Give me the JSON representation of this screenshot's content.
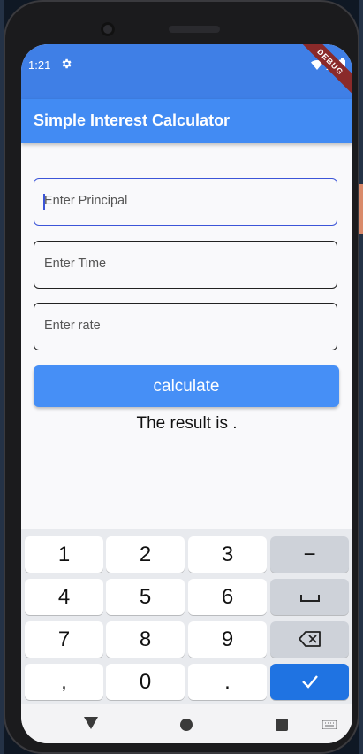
{
  "status_bar": {
    "time": "1:21",
    "debug_label": "DEBUG"
  },
  "app_bar": {
    "title": "Simple Interest Calculator"
  },
  "form": {
    "principal_placeholder": "Enter Principal",
    "time_placeholder": "Enter Time",
    "rate_placeholder": "Enter rate",
    "calculate_label": "calculate",
    "result_text": "The result is ."
  },
  "keyboard": {
    "rows": [
      [
        "1",
        "2",
        "3",
        "−"
      ],
      [
        "4",
        "5",
        "6",
        "space-icon"
      ],
      [
        "7",
        "8",
        "9",
        "backspace-icon"
      ],
      [
        ",",
        "0",
        ".",
        "check-icon"
      ]
    ]
  },
  "colors": {
    "status_bar": "#3f7fe6",
    "app_bar": "#428bf3",
    "button": "#468ff6",
    "focus_border": "#3c55d8",
    "done_key": "#1f73e2"
  },
  "icons": [
    "settings-gear-icon",
    "wifi-icon",
    "signal-icon",
    "battery-icon",
    "back-triangle-icon",
    "home-circle-icon",
    "recents-square-icon",
    "keyboard-switch-icon"
  ]
}
